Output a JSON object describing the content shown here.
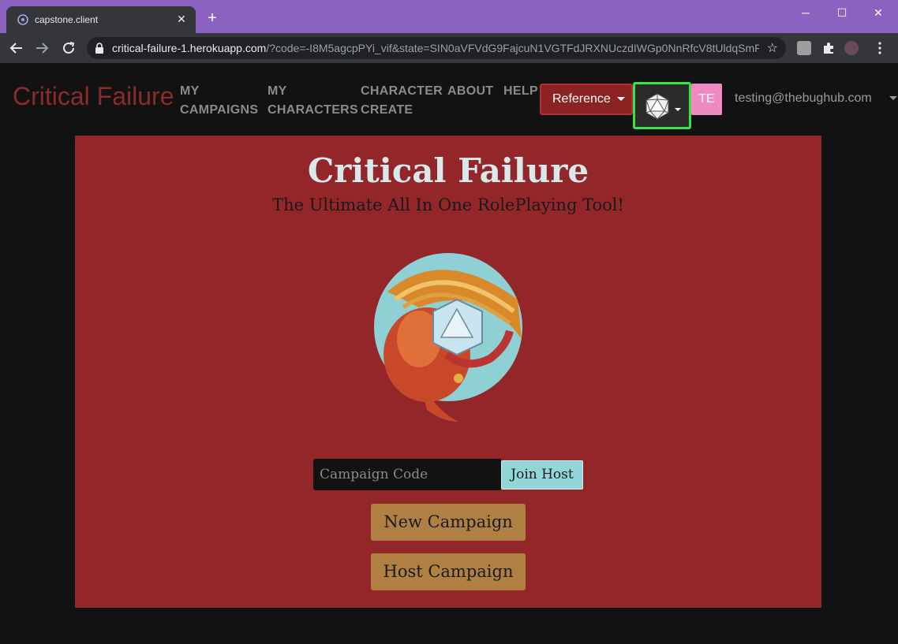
{
  "browser": {
    "tab_title": "capstone.client",
    "tab_close": "✕",
    "new_tab": "+",
    "url_host": "critical-failure-1.herokuapp.com",
    "url_rest": "/?code=-I8M5agcpPYi_vif&state=SIN0aVFVdG9FajcuN1VGTFdJRXNUczdIWGp0NnRfcV8tUldqSmR...",
    "window_controls": [
      "─",
      "☐",
      "✕"
    ],
    "nav_icons": [
      "back-arrow-icon",
      "forward-arrow-icon",
      "reload-icon"
    ]
  },
  "navbar": {
    "brand": "Critical Failure",
    "links": [
      {
        "line1": "MY",
        "line2": "CAMPAIGNS"
      },
      {
        "line1": "MY",
        "line2": "CHARACTERS"
      },
      {
        "line1": "CHARACTER",
        "line2": "CREATE"
      },
      {
        "line1": "ABOUT",
        "line2": ""
      },
      {
        "line1": "HELP",
        "line2": ""
      }
    ],
    "reference_label": "Reference",
    "avatar_initials": "TE",
    "user_email": "testing@thebughub.com"
  },
  "hero": {
    "title": "Critical Failure",
    "subtitle": "The Ultimate All In One RolePlaying Tool!",
    "code_placeholder": "Campaign Code",
    "join_label": "Join Host",
    "new_campaign_label": "New Campaign",
    "host_campaign_label": "Host Campaign"
  },
  "colors": {
    "panel": "#932629",
    "brand": "#8c2b2b",
    "gold_button": "#b08043",
    "join_button": "#93d6d8",
    "highlight": "#39e24a"
  }
}
